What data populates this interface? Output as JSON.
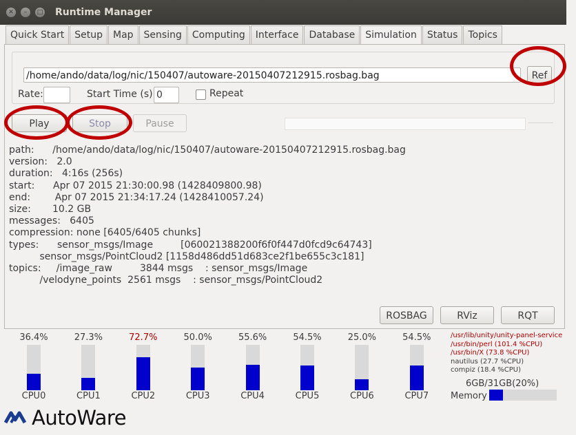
{
  "window": {
    "title": "Runtime Manager"
  },
  "tabs": [
    "Quick Start",
    "Setup",
    "Map",
    "Sensing",
    "Computing",
    "Interface",
    "Database",
    "Simulation",
    "Status",
    "Topics"
  ],
  "active_tab": "Simulation",
  "sim": {
    "path_value": "/home/ando/data/log/nic/150407/autoware-20150407212915.rosbag.bag",
    "ref_label": "Ref",
    "rate_label": "Rate:",
    "rate_value": "",
    "start_time_label": "Start Time (s):",
    "start_time_value": "0",
    "repeat_label": "Repeat",
    "play_label": "Play",
    "stop_label": "Stop",
    "pause_label": "Pause",
    "info_lines": [
      "path:      /home/ando/data/log/nic/150407/autoware-20150407212915.rosbag.bag",
      "version:   2.0",
      "duration:   4:16s (256s)",
      "start:      Apr 07 2015 21:30:00.98 (1428409800.98)",
      "end:        Apr 07 2015 21:34:17.24 (1428410057.24)",
      "size:       10.2 GB",
      "messages:   6405",
      "compression: none [6405/6405 chunks]",
      "types:      sensor_msgs/Image         [060021388200f6f0f447d0fcd9c64743]",
      "          sensor_msgs/PointCloud2 [1158d486dd51d683ce2f1be655c3c181]",
      "topics:     /image_raw         3844 msgs    : sensor_msgs/Image",
      "          /velodyne_points  2561 msgs    : sensor_msgs/PointCloud2"
    ],
    "rosbag_label": "ROSBAG",
    "rviz_label": "RViz",
    "rqt_label": "RQT"
  },
  "cpus": [
    {
      "name": "CPU0",
      "pct": "36.4%",
      "value": 36.4,
      "warn": false
    },
    {
      "name": "CPU1",
      "pct": "27.3%",
      "value": 27.3,
      "warn": false
    },
    {
      "name": "CPU2",
      "pct": "72.7%",
      "value": 72.7,
      "warn": true
    },
    {
      "name": "CPU3",
      "pct": "50.0%",
      "value": 50.0,
      "warn": false
    },
    {
      "name": "CPU4",
      "pct": "55.6%",
      "value": 55.6,
      "warn": false
    },
    {
      "name": "CPU5",
      "pct": "54.5%",
      "value": 54.5,
      "warn": false
    },
    {
      "name": "CPU6",
      "pct": "25.0%",
      "value": 25.0,
      "warn": false
    },
    {
      "name": "CPU7",
      "pct": "54.5%",
      "value": 54.5,
      "warn": false
    }
  ],
  "processes": [
    {
      "text": "/usr/lib/unity/unity-panel-service",
      "warn": true
    },
    {
      "text": "/usr/bin/perl (101.4 %CPU)",
      "warn": true
    },
    {
      "text": "/usr/bin/X (73.8 %CPU)",
      "warn": true
    },
    {
      "text": "nautilus (27.7 %CPU)",
      "warn": false
    },
    {
      "text": "compiz (18.4 %CPU)",
      "warn": false
    }
  ],
  "memory": {
    "text": "6GB/31GB(20%)",
    "label": "Memory",
    "value": 20
  },
  "logo": {
    "text": "AutoWare"
  },
  "colors": {
    "accent_red": "#c00000",
    "bar_blue": "#0000cc",
    "warn_text": "#b00000"
  }
}
